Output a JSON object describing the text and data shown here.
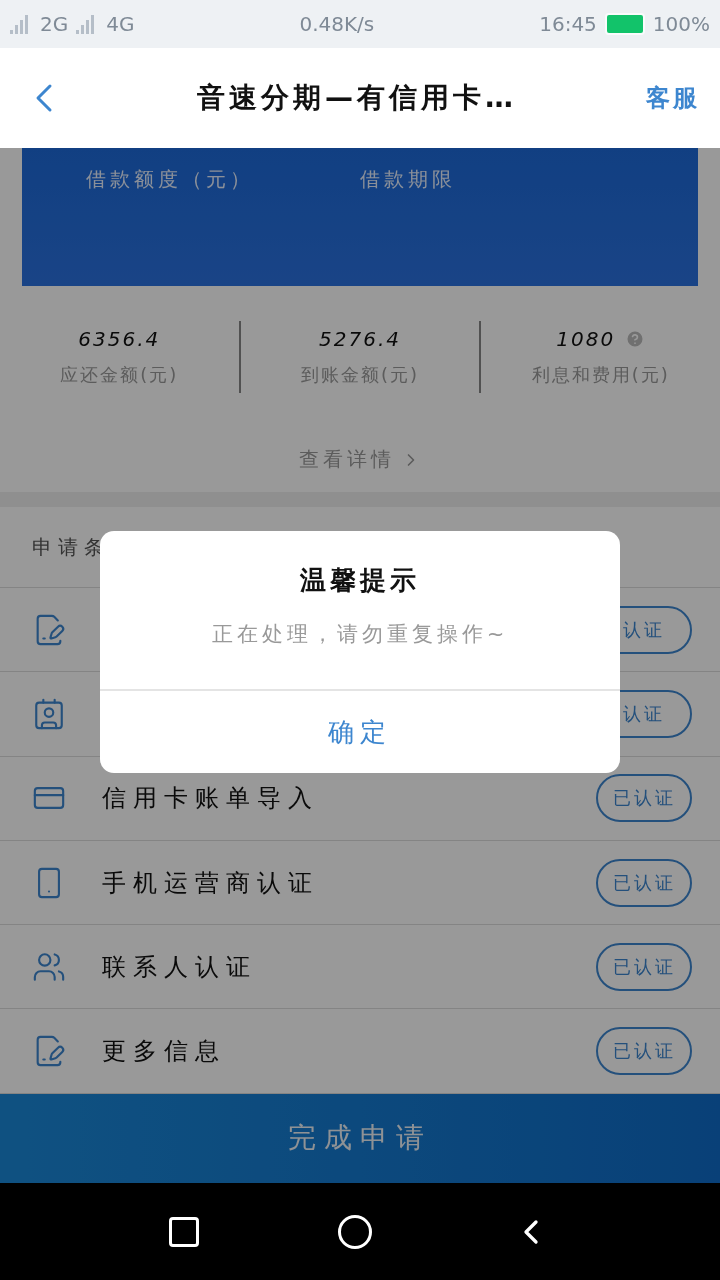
{
  "status_bar": {
    "network_1": "2G",
    "network_2": "4G",
    "speed": "0.48K/s",
    "time": "16:45",
    "battery": "100%"
  },
  "header": {
    "title": "音速分期—有信用卡…",
    "action": "客服"
  },
  "loan_card": {
    "labels": [
      "借款额度（元）",
      "借款期限"
    ]
  },
  "summary": [
    {
      "value": "6356.4",
      "label": "应还金额(元)",
      "help": false
    },
    {
      "value": "5276.4",
      "label": "到账金额(元)",
      "help": false
    },
    {
      "value": "1080",
      "label": "利息和费用(元)",
      "help": true
    }
  ],
  "details_link": "查看详情",
  "section_title": "申请条",
  "items": [
    {
      "kind": "form",
      "status": "认证"
    },
    {
      "kind": "id",
      "status": "认证"
    },
    {
      "kind": "card",
      "label": "信用卡账单导入",
      "status": "已认证"
    },
    {
      "kind": "phone",
      "label": "手机运营商认证",
      "status": "已认证"
    },
    {
      "kind": "contacts",
      "label": "联系人认证",
      "status": "已认证"
    },
    {
      "kind": "form",
      "label": "更多信息",
      "status": "已认证"
    }
  ],
  "submit": "完成申请",
  "dialog": {
    "title": "温馨提示",
    "message": "正在处理，请勿重复操作~",
    "confirm": "确定"
  }
}
